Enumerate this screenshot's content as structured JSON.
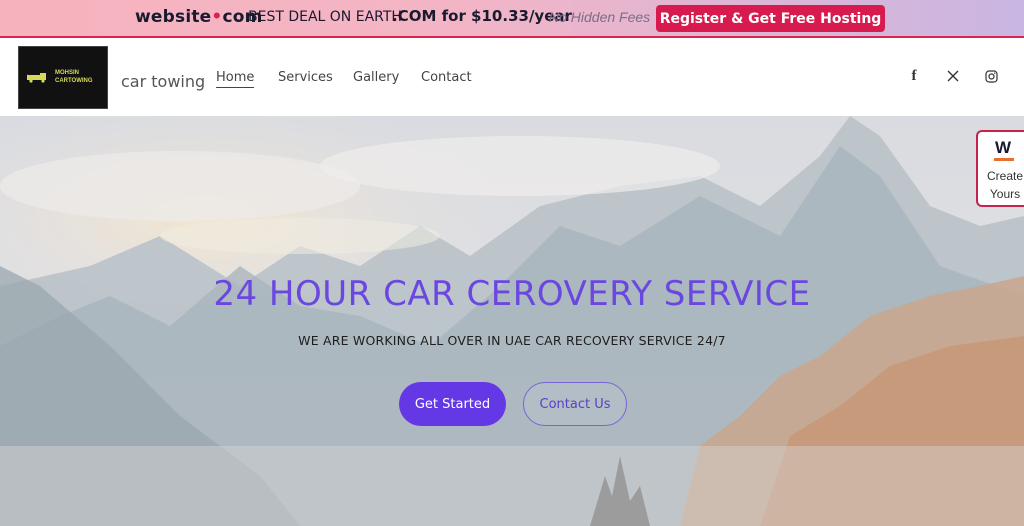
{
  "promo": {
    "brand_left": "website",
    "brand_dot": "•",
    "brand_right": "com",
    "colon": ":",
    "deal": "BEST DEAL ON EARTH",
    "price": ".COM for $10.33/year",
    "fees": "No Hidden Fees",
    "cta": "Register & Get Free Hosting"
  },
  "header": {
    "logo_line1": "MOHSIN",
    "logo_line2": "CARTOWING",
    "site_name": "car towing",
    "nav": [
      "Home",
      "Services",
      "Gallery",
      "Contact"
    ],
    "social_icons": [
      "facebook-icon",
      "x-icon",
      "instagram-icon"
    ],
    "facebook_glyph": "f",
    "x_glyph": "𝕏"
  },
  "hero": {
    "title": "24 HOUR CAR CEROVERY SERVICE",
    "subtitle": "WE ARE WORKING ALL OVER IN UAE CAR RECOVERY SERVICE 24/7",
    "primary_button": "Get Started",
    "secondary_button": "Contact Us"
  },
  "widget": {
    "logo": "W",
    "line1": "Create",
    "line2": "Yours"
  },
  "colors": {
    "accent": "#6538e6",
    "promo_cta": "#d81b4f",
    "title": "#6a48e0"
  }
}
